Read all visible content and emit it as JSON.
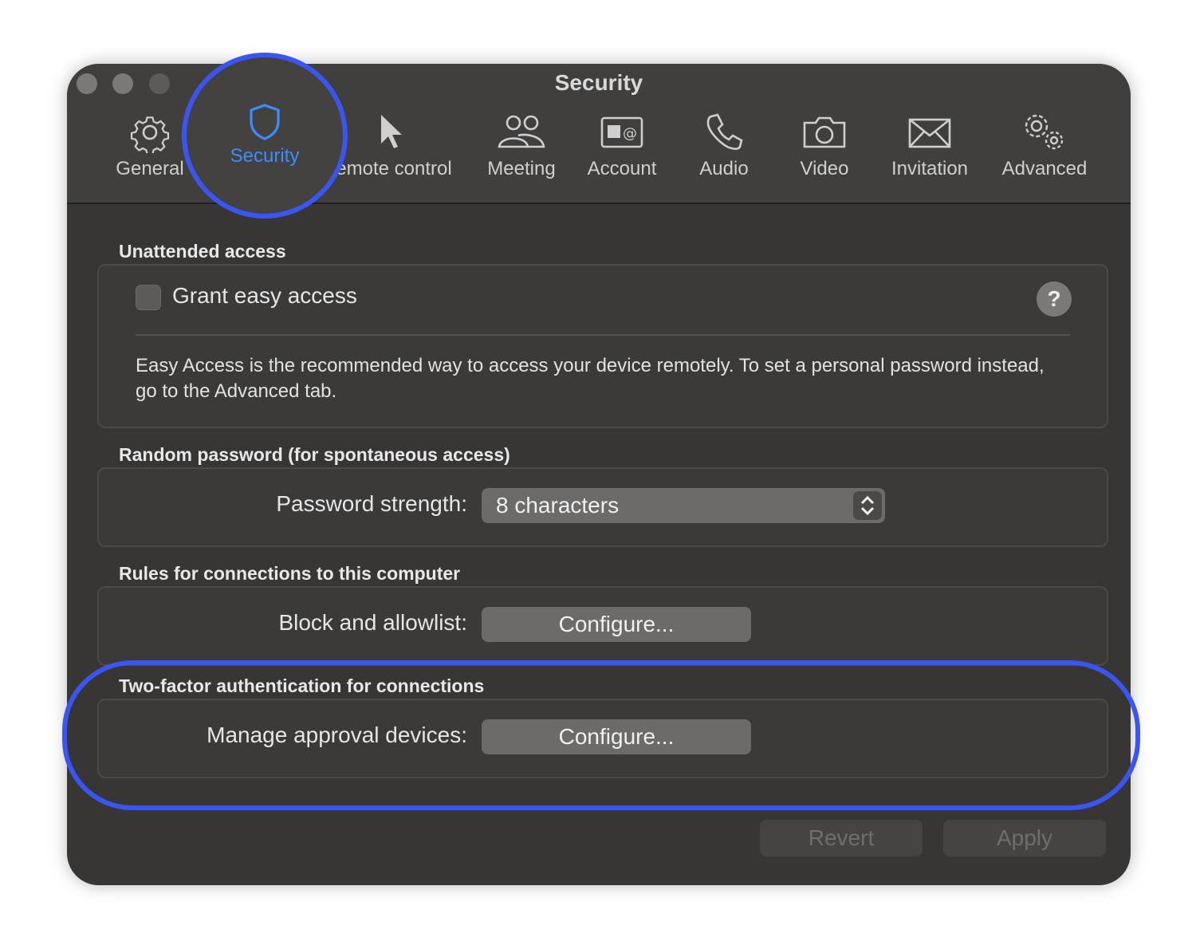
{
  "window": {
    "title": "Security"
  },
  "tabs": [
    {
      "label": "General",
      "icon": "gear-icon"
    },
    {
      "label": "Security",
      "icon": "shield-icon",
      "active": true
    },
    {
      "label": "emote control",
      "icon": "pointer-icon"
    },
    {
      "label": "Meeting",
      "icon": "people-icon"
    },
    {
      "label": "Account",
      "icon": "contact-card-icon"
    },
    {
      "label": "Audio",
      "icon": "phone-icon"
    },
    {
      "label": "Video",
      "icon": "camera-icon"
    },
    {
      "label": "Invitation",
      "icon": "envelope-icon"
    },
    {
      "label": "Advanced",
      "icon": "gears-icon"
    }
  ],
  "unattended": {
    "title": "Unattended access",
    "checkbox_label": "Grant easy access",
    "checked": false,
    "help": "?",
    "description": "Easy Access is the recommended way to access your device remotely. To set a personal password instead, go to the Advanced tab."
  },
  "random_password": {
    "title": "Random password (for spontaneous access)",
    "label": "Password strength:",
    "value": "8 characters"
  },
  "rules": {
    "title": "Rules for connections to this computer",
    "label": "Block and allowlist:",
    "button": "Configure..."
  },
  "two_factor": {
    "title": "Two-factor authentication for connections",
    "label": "Manage approval devices:",
    "button": "Configure..."
  },
  "footer": {
    "revert": "Revert",
    "apply": "Apply"
  },
  "colors": {
    "highlight": "#3a55f2",
    "active_tab": "#3c8cff",
    "window_bg": "#373635"
  }
}
